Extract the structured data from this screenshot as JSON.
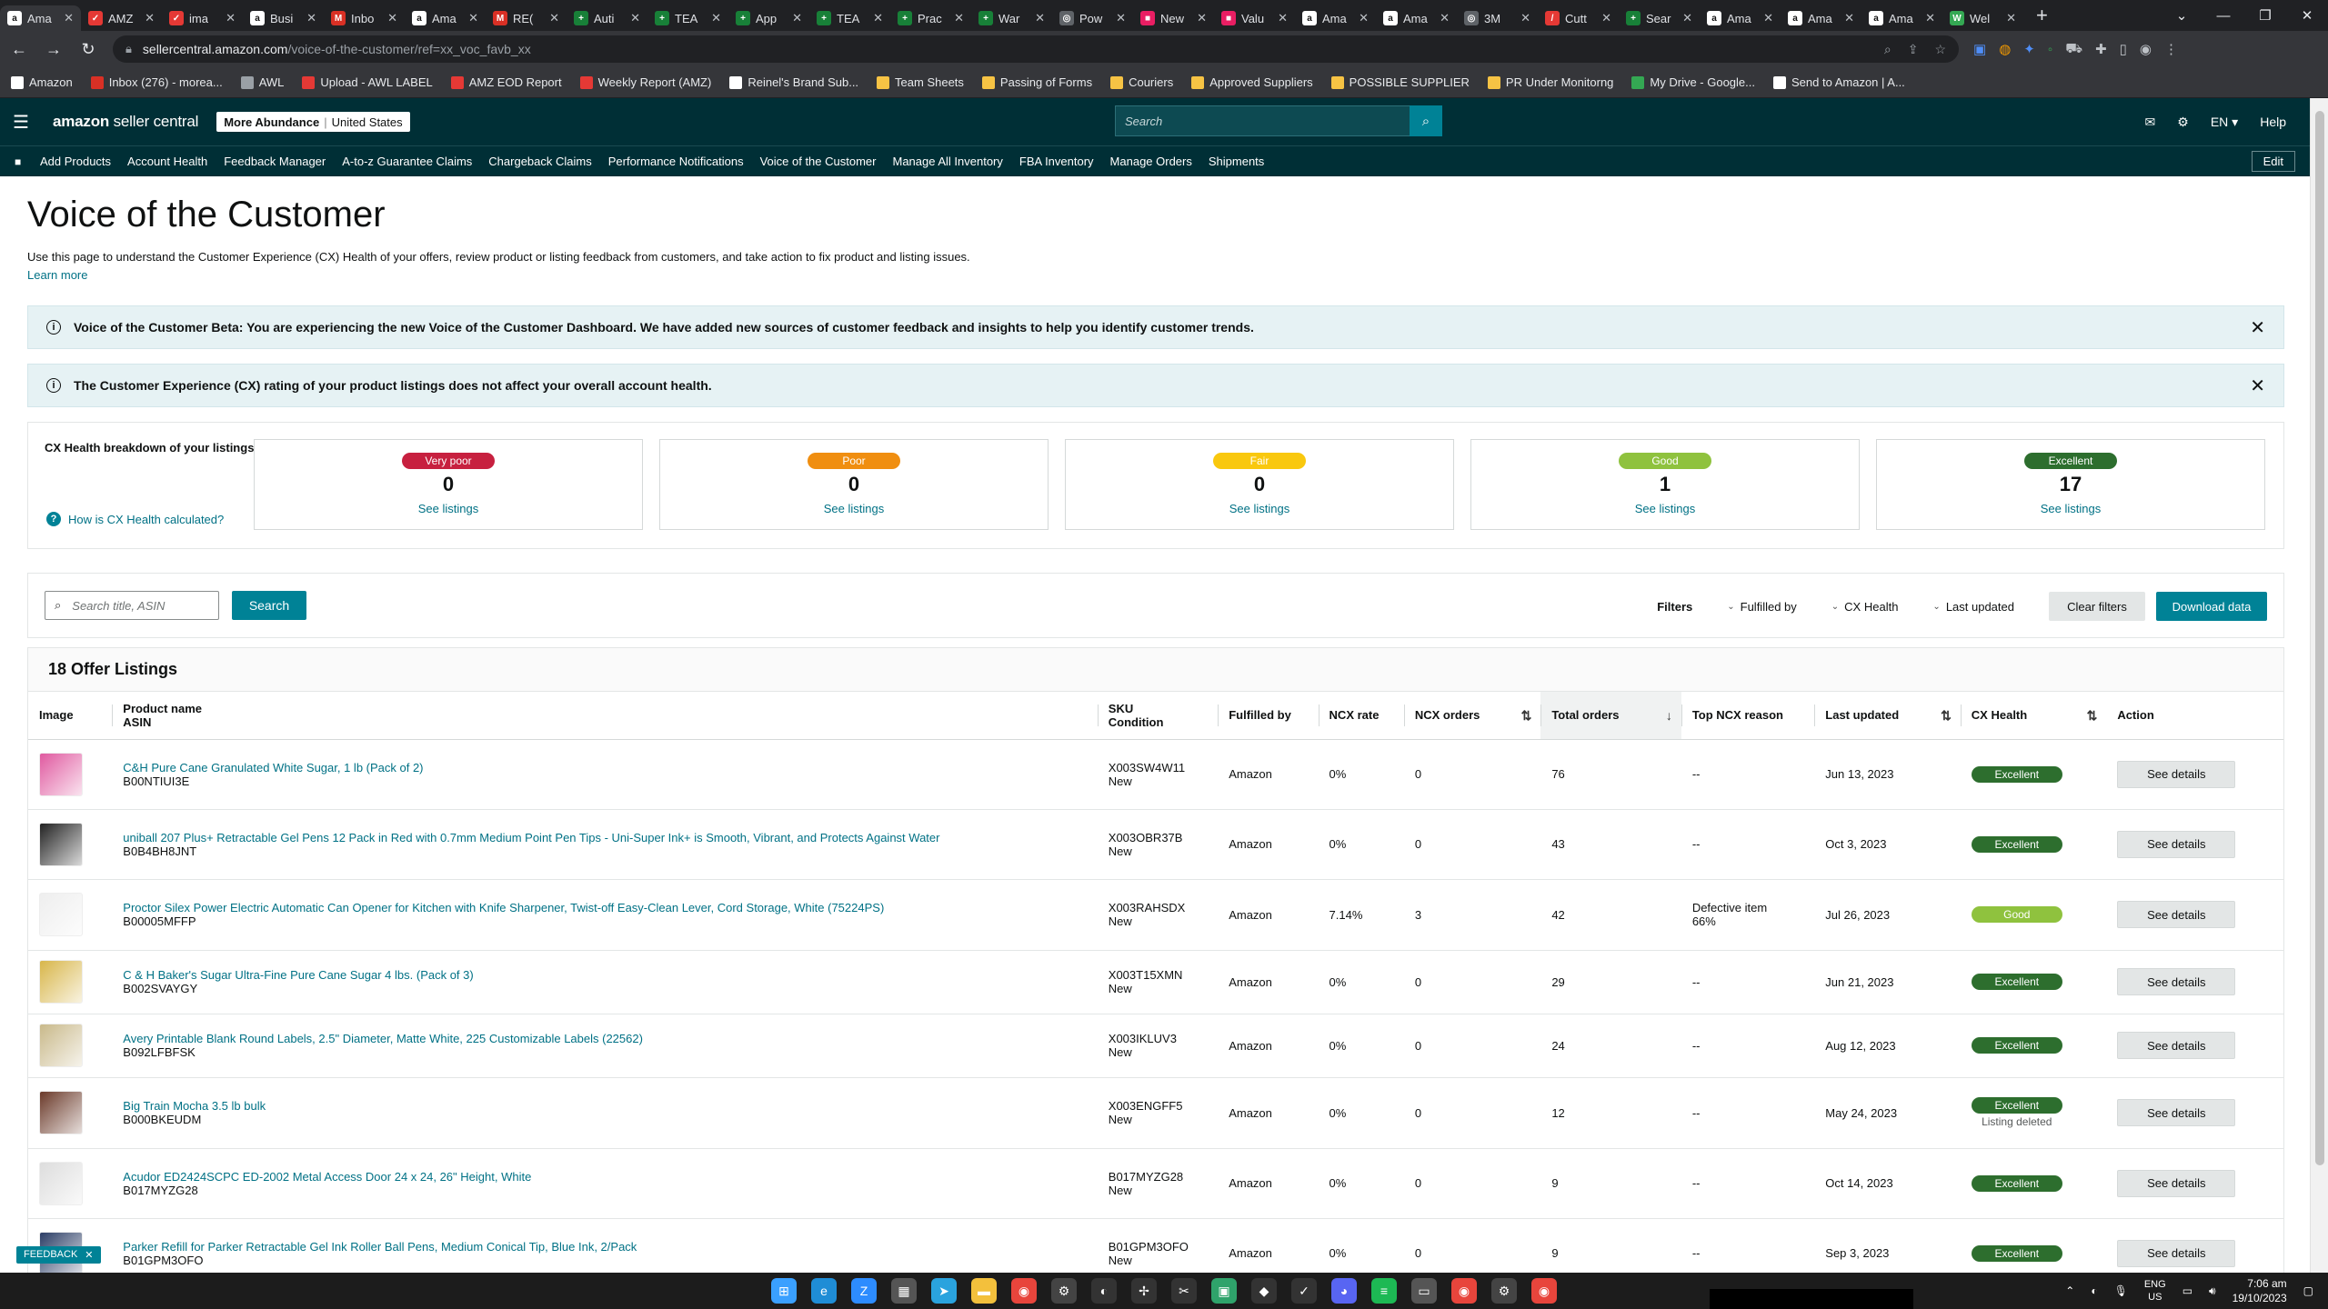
{
  "browser": {
    "tabs": [
      {
        "label": "Ama",
        "color": "#ffffff",
        "glyph": "a",
        "active": true
      },
      {
        "label": "AMZ",
        "color": "#e53935",
        "glyph": "✓"
      },
      {
        "label": "ima",
        "color": "#e53935",
        "glyph": "✓"
      },
      {
        "label": "Busi",
        "color": "#ffffff",
        "glyph": "a"
      },
      {
        "label": "Inbo",
        "color": "#d93025",
        "glyph": "M"
      },
      {
        "label": "Ama",
        "color": "#ffffff",
        "glyph": "a"
      },
      {
        "label": "RE(",
        "color": "#d93025",
        "glyph": "M"
      },
      {
        "label": "Auti",
        "color": "#188038",
        "glyph": "+"
      },
      {
        "label": "TEA",
        "color": "#188038",
        "glyph": "+"
      },
      {
        "label": "App",
        "color": "#188038",
        "glyph": "+"
      },
      {
        "label": "TEA",
        "color": "#188038",
        "glyph": "+"
      },
      {
        "label": "Prac",
        "color": "#188038",
        "glyph": "+"
      },
      {
        "label": "War",
        "color": "#188038",
        "glyph": "+"
      },
      {
        "label": "Pow",
        "color": "#5f6368",
        "glyph": "◎"
      },
      {
        "label": "New",
        "color": "#e91e63",
        "glyph": "■"
      },
      {
        "label": "Valu",
        "color": "#e91e63",
        "glyph": "■"
      },
      {
        "label": "Ama",
        "color": "#ffffff",
        "glyph": "a"
      },
      {
        "label": "Ama",
        "color": "#ffffff",
        "glyph": "a"
      },
      {
        "label": "3M",
        "color": "#5f6368",
        "glyph": "◎"
      },
      {
        "label": "Cutt",
        "color": "#e53935",
        "glyph": "/"
      },
      {
        "label": "Sear",
        "color": "#188038",
        "glyph": "+"
      },
      {
        "label": "Ama",
        "color": "#ffffff",
        "glyph": "a"
      },
      {
        "label": "Ama",
        "color": "#ffffff",
        "glyph": "a"
      },
      {
        "label": "Ama",
        "color": "#ffffff",
        "glyph": "a"
      },
      {
        "label": "Wel",
        "color": "#34a853",
        "glyph": "W"
      }
    ],
    "url_host": "sellercentral.amazon.com",
    "url_path": "/voice-of-the-customer/ref=xx_voc_favb_xx",
    "bookmarks": [
      {
        "label": "Amazon",
        "color": "#ffffff"
      },
      {
        "label": "Inbox (276) - morea...",
        "color": "#d93025"
      },
      {
        "label": "AWL",
        "color": "#9aa0a6"
      },
      {
        "label": "Upload - AWL LABEL",
        "color": "#e53935"
      },
      {
        "label": "AMZ EOD Report",
        "color": "#e53935"
      },
      {
        "label": "Weekly Report (AMZ)",
        "color": "#e53935"
      },
      {
        "label": "Reinel's Brand Sub...",
        "color": "#ffffff"
      },
      {
        "label": "Team Sheets",
        "color": "#f6c344"
      },
      {
        "label": "Passing of Forms",
        "color": "#f6c344"
      },
      {
        "label": "Couriers",
        "color": "#f6c344"
      },
      {
        "label": "Approved Suppliers",
        "color": "#f6c344"
      },
      {
        "label": "POSSIBLE SUPPLIER",
        "color": "#f6c344"
      },
      {
        "label": "PR Under Monitorng",
        "color": "#f6c344"
      },
      {
        "label": "My Drive - Google...",
        "color": "#34a853"
      },
      {
        "label": "Send to Amazon | A...",
        "color": "#ffffff"
      }
    ]
  },
  "header": {
    "logo_main": "amazon",
    "logo_sub": "seller central",
    "store": "More Abundance",
    "marketplace": "United States",
    "search_placeholder": "Search",
    "lang": "EN ▾",
    "help": "Help"
  },
  "nav": {
    "items": [
      "Add Products",
      "Account Health",
      "Feedback Manager",
      "A-to-z Guarantee Claims",
      "Chargeback Claims",
      "Performance Notifications",
      "Voice of the Customer",
      "Manage All Inventory",
      "FBA Inventory",
      "Manage Orders",
      "Shipments"
    ],
    "edit": "Edit"
  },
  "page": {
    "title": "Voice of the Customer",
    "intro": "Use this page to understand the Customer Experience (CX) Health of your offers, review product or listing feedback from customers, and take action to fix product and listing issues.",
    "learn_more": "Learn more",
    "alert1": "Voice of the Customer Beta: You are experiencing the new Voice of the Customer Dashboard. We have added new sources of customer feedback and insights to help you identify customer trends.",
    "alert2": "The Customer Experience (CX) rating of your product listings does not affect your overall account health."
  },
  "cx": {
    "label": "CX Health breakdown of your listings",
    "how_link": "How is CX Health calculated?",
    "see_listings": "See listings",
    "cards": [
      {
        "badge": "Very poor",
        "count": "0",
        "color": "#c7203f",
        "text_color": "#ffffff"
      },
      {
        "badge": "Poor",
        "count": "0",
        "color": "#f08e10",
        "text_color": "#ffffff"
      },
      {
        "badge": "Fair",
        "count": "0",
        "color": "#f9c80e",
        "text_color": "#ffffff"
      },
      {
        "badge": "Good",
        "count": "1",
        "color": "#8fc23e",
        "text_color": "#ffffff"
      },
      {
        "badge": "Excellent",
        "count": "17",
        "color": "#2d6e2e",
        "text_color": "#ffffff"
      }
    ]
  },
  "filters": {
    "search_placeholder": "Search title, ASIN",
    "search_button": "Search",
    "label": "Filters",
    "fulfilled_by": "Fulfilled by",
    "cx_health": "CX Health",
    "last_updated": "Last updated",
    "clear": "Clear filters",
    "download": "Download data"
  },
  "table": {
    "title": "18 Offer Listings",
    "headers": {
      "image": "Image",
      "product_name": "Product name",
      "asin": "ASIN",
      "sku": "SKU",
      "condition": "Condition",
      "fulfilled_by": "Fulfilled by",
      "ncx_rate": "NCX rate",
      "ncx_orders": "NCX orders",
      "total_orders": "Total orders",
      "top_reason": "Top NCX reason",
      "last_updated": "Last updated",
      "cx_health": "CX Health",
      "action": "Action"
    },
    "rows": [
      {
        "name": "C&H Pure Cane Granulated White Sugar, 1 lb (Pack of 2)",
        "asin": "B00NTIUI3E",
        "sku": "X003SW4W11",
        "condition": "New",
        "fulfilled": "Amazon",
        "ncx_rate": "0%",
        "ncx_orders": "0",
        "total": "76",
        "reason": "--",
        "reason_sub": "",
        "updated": "Jun 13, 2023",
        "health": "Excellent",
        "health_color": "#2d6e2e",
        "note": "",
        "action": "See details",
        "thumb": "#e05aa0"
      },
      {
        "name": "uniball 207 Plus+ Retractable Gel Pens 12 Pack in Red with 0.7mm Medium Point Pen Tips - Uni-Super Ink+ is Smooth, Vibrant, and Protects Against Water",
        "asin": "B0B4BH8JNT",
        "sku": "X003OBR37B",
        "condition": "New",
        "fulfilled": "Amazon",
        "ncx_rate": "0%",
        "ncx_orders": "0",
        "total": "43",
        "reason": "--",
        "reason_sub": "",
        "updated": "Oct 3, 2023",
        "health": "Excellent",
        "health_color": "#2d6e2e",
        "note": "",
        "action": "See details",
        "thumb": "#222222"
      },
      {
        "name": "Proctor Silex Power Electric Automatic Can Opener for Kitchen with Knife Sharpener, Twist-off Easy-Clean Lever, Cord Storage, White (75224PS)",
        "asin": "B00005MFFP",
        "sku": "X003RAHSDX",
        "condition": "New",
        "fulfilled": "Amazon",
        "ncx_rate": "7.14%",
        "ncx_orders": "3",
        "total": "42",
        "reason": "Defective item",
        "reason_sub": "66%",
        "updated": "Jul 26, 2023",
        "health": "Good",
        "health_color": "#8fc23e",
        "note": "",
        "action": "See details",
        "thumb": "#eeeeee"
      },
      {
        "name": "C & H Baker's Sugar Ultra-Fine Pure Cane Sugar 4 lbs. (Pack of 3)",
        "asin": "B002SVAYGY",
        "sku": "X003T15XMN",
        "condition": "New",
        "fulfilled": "Amazon",
        "ncx_rate": "0%",
        "ncx_orders": "0",
        "total": "29",
        "reason": "--",
        "reason_sub": "",
        "updated": "Jun 21, 2023",
        "health": "Excellent",
        "health_color": "#2d6e2e",
        "note": "",
        "action": "See details",
        "thumb": "#d8b64a"
      },
      {
        "name": "Avery Printable Blank Round Labels, 2.5\" Diameter, Matte White, 225 Customizable Labels (22562)",
        "asin": "B092LFBFSK",
        "sku": "X003IKLUV3",
        "condition": "New",
        "fulfilled": "Amazon",
        "ncx_rate": "0%",
        "ncx_orders": "0",
        "total": "24",
        "reason": "--",
        "reason_sub": "",
        "updated": "Aug 12, 2023",
        "health": "Excellent",
        "health_color": "#2d6e2e",
        "note": "",
        "action": "See details",
        "thumb": "#c9b98a"
      },
      {
        "name": "Big Train Mocha 3.5 lb bulk",
        "asin": "B000BKEUDM",
        "sku": "X003ENGFF5",
        "condition": "New",
        "fulfilled": "Amazon",
        "ncx_rate": "0%",
        "ncx_orders": "0",
        "total": "12",
        "reason": "--",
        "reason_sub": "",
        "updated": "May 24, 2023",
        "health": "Excellent",
        "health_color": "#2d6e2e",
        "note": "Listing deleted",
        "action": "See details",
        "thumb": "#6b3a2a"
      },
      {
        "name": "Acudor ED2424SCPC ED-2002 Metal Access Door 24 x 24, 26\" Height, White",
        "asin": "B017MYZG28",
        "sku": "B017MYZG28",
        "condition": "New",
        "fulfilled": "Amazon",
        "ncx_rate": "0%",
        "ncx_orders": "0",
        "total": "9",
        "reason": "--",
        "reason_sub": "",
        "updated": "Oct 14, 2023",
        "health": "Excellent",
        "health_color": "#2d6e2e",
        "note": "",
        "action": "See details",
        "thumb": "#dddddd"
      },
      {
        "name": "Parker Refill for Parker Retractable Gel Ink Roller Ball Pens, Medium Conical Tip, Blue Ink, 2/Pack",
        "asin": "B01GPM3OFO",
        "sku": "B01GPM3OFO",
        "condition": "New",
        "fulfilled": "Amazon",
        "ncx_rate": "0%",
        "ncx_orders": "0",
        "total": "9",
        "reason": "--",
        "reason_sub": "",
        "updated": "Sep 3, 2023",
        "health": "Excellent",
        "health_color": "#2d6e2e",
        "note": "",
        "action": "See details",
        "thumb": "#2c3e66"
      }
    ]
  },
  "feedback": "FEEDBACK",
  "taskbar": {
    "lang_top": "ENG",
    "lang_bottom": "US",
    "time": "7:06 am",
    "date": "19/10/2023",
    "apps": [
      {
        "name": "windows-start-icon",
        "color": "#3aa0ff",
        "glyph": "⊞"
      },
      {
        "name": "edge-icon",
        "color": "#1f8dd6",
        "glyph": "e"
      },
      {
        "name": "zoom-icon",
        "color": "#2d8cff",
        "glyph": "Z"
      },
      {
        "name": "calculator-icon",
        "color": "#555555",
        "glyph": "▦"
      },
      {
        "name": "telegram-icon",
        "color": "#2aa3de",
        "glyph": "➤"
      },
      {
        "name": "file-explorer-icon",
        "color": "#f3c03c",
        "glyph": "▬"
      },
      {
        "name": "chrome-icon",
        "color": "#e8453c",
        "glyph": "◉"
      },
      {
        "name": "settings-icon",
        "color": "#444444",
        "glyph": "⚙"
      },
      {
        "name": "app-icon",
        "color": "#333333",
        "glyph": "◐"
      },
      {
        "name": "app-icon",
        "color": "#333333",
        "glyph": "✢"
      },
      {
        "name": "app-icon",
        "color": "#333333",
        "glyph": "✂"
      },
      {
        "name": "app-icon",
        "color": "#2fa36b",
        "glyph": "▣"
      },
      {
        "name": "app-icon",
        "color": "#333333",
        "glyph": "◆"
      },
      {
        "name": "app-icon",
        "color": "#333333",
        "glyph": "✓"
      },
      {
        "name": "discord-icon",
        "color": "#5865f2",
        "glyph": "◕"
      },
      {
        "name": "spotify-icon",
        "color": "#1db954",
        "glyph": "≡"
      },
      {
        "name": "app-icon",
        "color": "#555555",
        "glyph": "▭"
      },
      {
        "name": "chrome-icon",
        "color": "#e8453c",
        "glyph": "◉"
      },
      {
        "name": "settings-icon",
        "color": "#444444",
        "glyph": "⚙"
      },
      {
        "name": "chrome-icon",
        "color": "#e8453c",
        "glyph": "◉"
      }
    ]
  }
}
